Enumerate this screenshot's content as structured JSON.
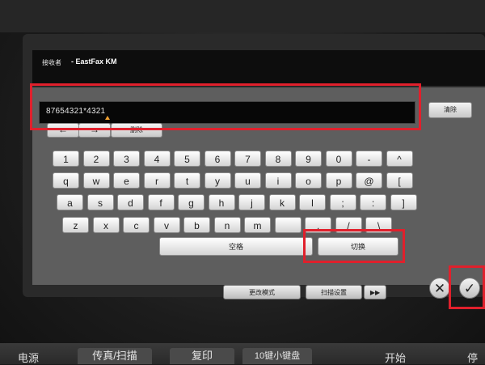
{
  "header": {
    "recipient_label": "接收者",
    "recipient_value": "- EastFax KM"
  },
  "input": {
    "value": "87654321*4321"
  },
  "controls": {
    "clear": "清除",
    "left_arrow": "←",
    "right_arrow": "→",
    "delete": "删除"
  },
  "keyboard": {
    "row1": [
      "1",
      "2",
      "3",
      "4",
      "5",
      "6",
      "7",
      "8",
      "9",
      "0",
      "-",
      "^"
    ],
    "row2": [
      "q",
      "w",
      "e",
      "r",
      "t",
      "y",
      "u",
      "i",
      "o",
      "p",
      "@",
      "["
    ],
    "row3": [
      "a",
      "s",
      "d",
      "f",
      "g",
      "h",
      "j",
      "k",
      "l",
      ";",
      ":",
      "]"
    ],
    "row4": [
      "z",
      "x",
      "c",
      "v",
      "b",
      "n",
      "m",
      "",
      ",",
      "/",
      "\\"
    ],
    "space": "空格",
    "switch": "切换"
  },
  "lower": {
    "change_mode": "更改模式",
    "scan_settings": "扫描设置",
    "next_icon": "▶▶"
  },
  "actions": {
    "cancel_icon": "✕",
    "ok_icon": "✓"
  },
  "hardware": {
    "power": "电源",
    "fax_scan": "传真/扫描",
    "copy": "复印",
    "keypad": "10键小键盘",
    "start": "开始",
    "stop": "停"
  },
  "colors": {
    "highlight": "#e0202c",
    "caret": "#f0a030"
  }
}
